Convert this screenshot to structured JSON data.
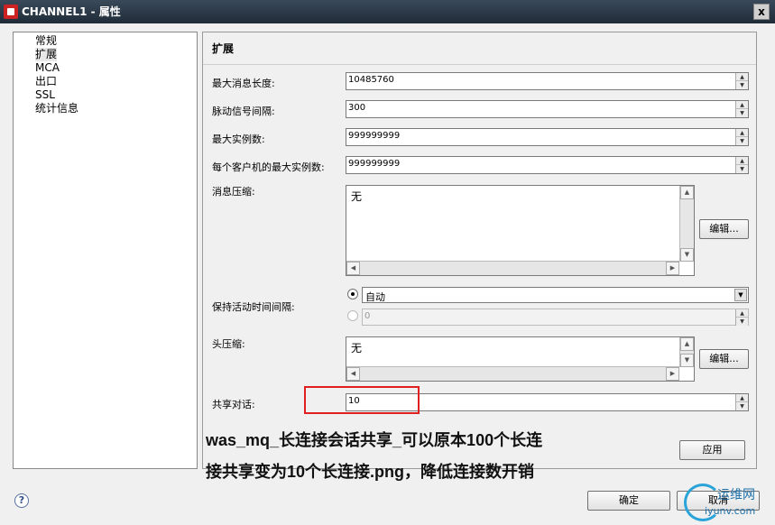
{
  "window": {
    "title": "CHANNEL1 - 属性",
    "close_label": "x"
  },
  "nav": {
    "items": [
      {
        "label": "常规"
      },
      {
        "label": "扩展"
      },
      {
        "label": "MCA"
      },
      {
        "label": "出口"
      },
      {
        "label": "SSL"
      },
      {
        "label": "统计信息"
      }
    ]
  },
  "panel": {
    "header": "扩展",
    "max_msg_len": {
      "label": "最大消息长度:",
      "value": "10485760"
    },
    "heartbeat": {
      "label": "脉动信号间隔:",
      "value": "300"
    },
    "max_instances": {
      "label": "最大实例数:",
      "value": "999999999"
    },
    "max_instances_client": {
      "label": "每个客户机的最大实例数:",
      "value": "999999999"
    },
    "msg_compression": {
      "label": "消息压缩:",
      "value": "无",
      "edit_label": "编辑..."
    },
    "keepalive": {
      "label": "保持活动时间间隔:",
      "auto_value": "自动",
      "manual_value": "0"
    },
    "hdr_compression": {
      "label": "头压缩:",
      "value": "无",
      "edit_label": "编辑..."
    },
    "share_conv": {
      "label": "共享对话:",
      "value": "10"
    },
    "apply_label": "应用"
  },
  "caption": {
    "line1": "was_mq_长连接会话共享_可以原本100个长连",
    "line2": "接共享变为10个长连接.png，降低连接数开销"
  },
  "footer": {
    "help": "?",
    "ok_label": "确定",
    "cancel_label": "取消"
  },
  "watermark": {
    "cn": "运维网",
    "en": "iyunv.com"
  }
}
